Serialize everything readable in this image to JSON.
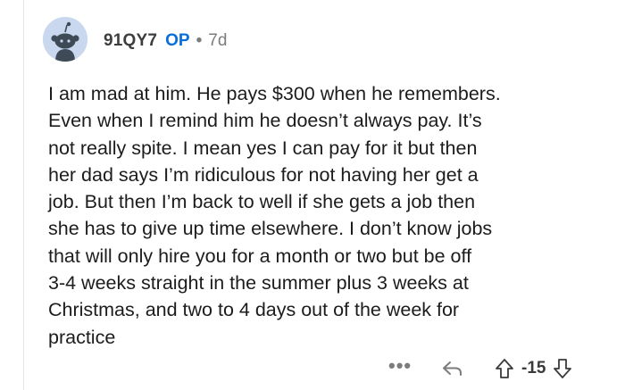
{
  "comment": {
    "author": "91QY7",
    "op_badge": "OP",
    "separator": "•",
    "age": "7d",
    "body": "I am mad at him. He pays $300 when he remembers.\nEven when I remind him he doesn’t always pay.  It’s\nnot really spite.  I mean yes I can pay for it but then\nher dad says I’m ridiculous for not having her get a\njob. But then I’m back to well if she gets a job then\nshe has to give up time elsewhere.  I don’t know jobs\nthat will only hire you for a month or two but be off\n3-4 weeks straight in the summer plus 3 weeks at\nChristmas, and two to 4 days out of the week for\npractice",
    "score": "-15",
    "icons": {
      "avatar": "snoo-avatar",
      "more": "more-icon",
      "reply": "reply-icon",
      "upvote": "upvote-icon",
      "downvote": "downvote-icon"
    },
    "colors": {
      "op_badge": "#0a6ddc",
      "avatar_bg": "#c9d8ef",
      "meta": "#7c7c7c"
    }
  },
  "actions": {
    "more_label": "•••"
  }
}
